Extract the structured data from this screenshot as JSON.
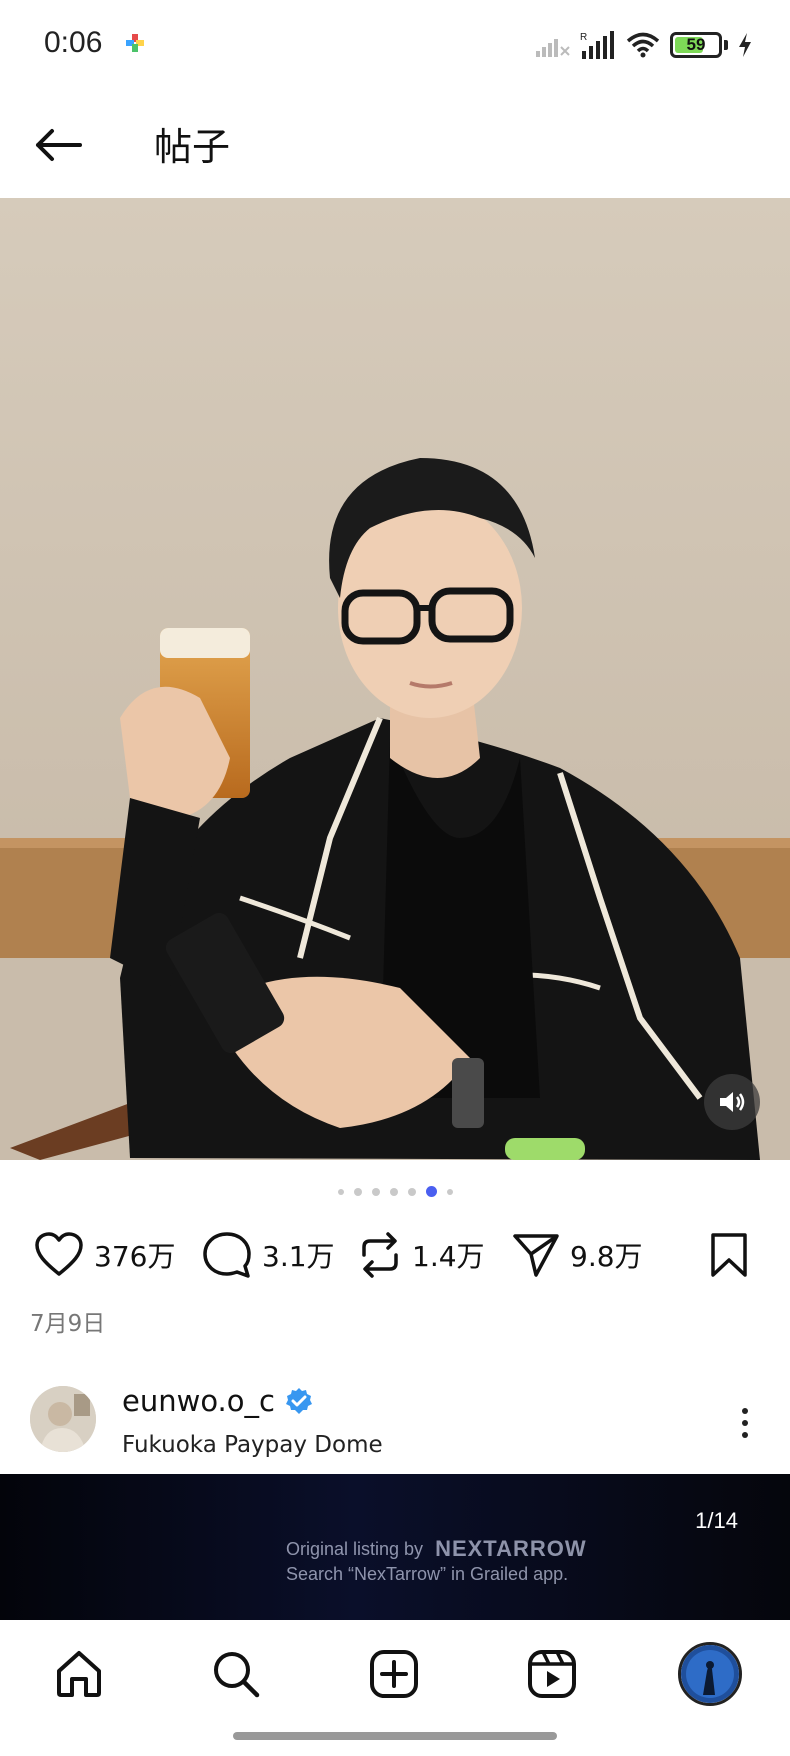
{
  "status_bar": {
    "time": "0:06",
    "battery_level": "59",
    "icons": [
      "app-notification-icon",
      "signal-off-icon",
      "signal-icon",
      "wifi-icon",
      "battery-icon",
      "charging-icon"
    ]
  },
  "header": {
    "back_icon": "arrow-left-icon",
    "title": "帖子"
  },
  "post": {
    "media_controls": {
      "mute_icon": "speaker-icon"
    },
    "carousel": {
      "count": 7,
      "active_index": 5
    },
    "actions": {
      "likes": "376万",
      "comments": "3.1万",
      "reposts": "1.4万",
      "shares": "9.8万"
    },
    "date": "7月9日",
    "author": {
      "username": "eunwo.o_c",
      "verified": true,
      "location": "Fukuoka Paypay Dome"
    }
  },
  "next_preview": {
    "slide_counter": "1/14",
    "watermark_prefix": "Original listing by",
    "watermark_brand": "NEXTARROW",
    "watermark_line2": "Search “NexTarrow” in Grailed app."
  },
  "bottom_nav": {
    "items": [
      "home-icon",
      "search-icon",
      "create-icon",
      "reels-icon",
      "profile-avatar"
    ]
  },
  "colors": {
    "accent": "#4a5ff0",
    "verified": "#3897f0",
    "battery_fill": "#7ed957"
  }
}
